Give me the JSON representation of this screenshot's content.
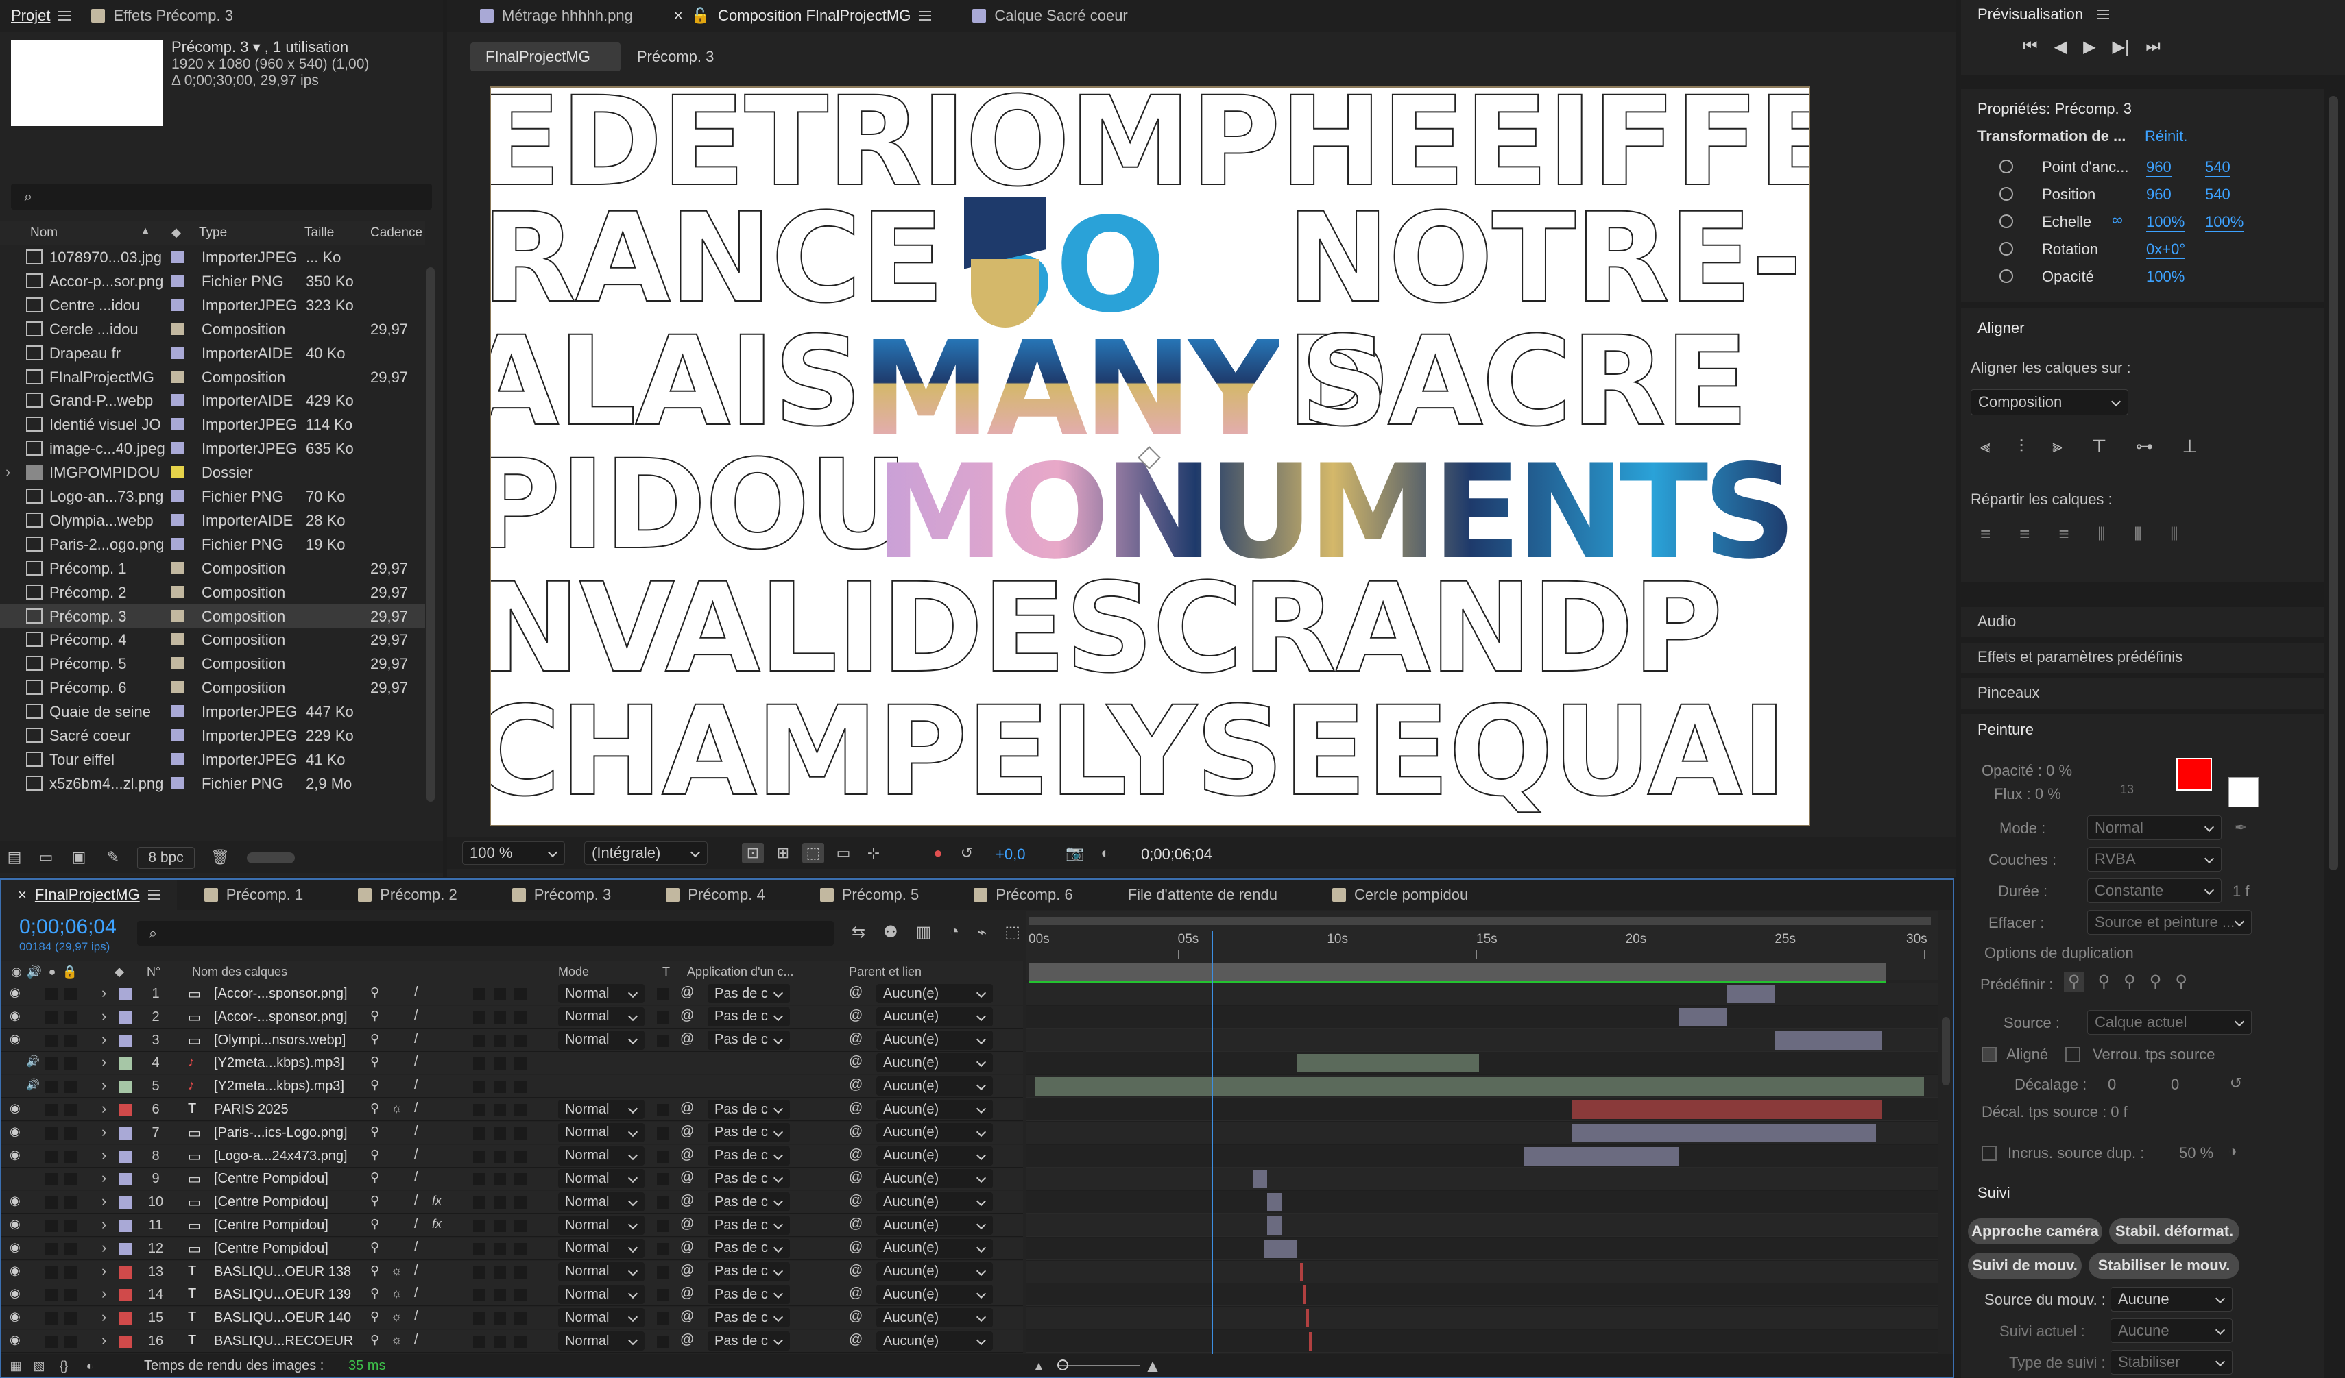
{
  "project": {
    "tab_project": "Projet",
    "tab_effects": "Effets Précomp. 3",
    "preview_name": "Précomp. 3 ▾ , 1 utilisation",
    "preview_dims": "1920 x 1080 (960 x 540) (1,00)",
    "preview_dur": "Δ 0;00;30;00, 29,97 ips",
    "search_placeholder": "",
    "columns": {
      "name": "Nom",
      "type": "Type",
      "size": "Taille",
      "rate": "Cadence"
    },
    "items": [
      {
        "name": "1078970...03.jpg",
        "type": "ImporterJPEG",
        "size": "... Ko",
        "rate": "",
        "color": "#a9a9d6",
        "icon": "image"
      },
      {
        "name": "Accor-p...sor.png",
        "type": "Fichier PNG",
        "size": "350 Ko",
        "rate": "",
        "color": "#a9a9d6",
        "icon": "image"
      },
      {
        "name": "Centre ...idou",
        "type": "ImporterJPEG",
        "size": "323 Ko",
        "rate": "",
        "color": "#a9a9d6",
        "icon": "image"
      },
      {
        "name": "Cercle ...idou",
        "type": "Composition",
        "size": "",
        "rate": "29,97",
        "color": "#c2b8a0",
        "icon": "comp"
      },
      {
        "name": "Drapeau fr",
        "type": "ImporterAIDE",
        "size": "40 Ko",
        "rate": "",
        "color": "#a9a9d6",
        "icon": "image"
      },
      {
        "name": "FInalProjectMG",
        "type": "Composition",
        "size": "",
        "rate": "29,97",
        "color": "#c2b8a0",
        "icon": "comp"
      },
      {
        "name": "Grand-P...webp",
        "type": "ImporterAIDE",
        "size": "429 Ko",
        "rate": "",
        "color": "#a9a9d6",
        "icon": "image"
      },
      {
        "name": "Identié visuel JO",
        "type": "ImporterJPEG",
        "size": "114 Ko",
        "rate": "",
        "color": "#a9a9d6",
        "icon": "image"
      },
      {
        "name": "image-c...40.jpeg",
        "type": "ImporterJPEG",
        "size": "635 Ko",
        "rate": "",
        "color": "#a9a9d6",
        "icon": "image"
      },
      {
        "name": "IMGPOMPIDOU",
        "type": "Dossier",
        "size": "",
        "rate": "",
        "color": "#e6d34a",
        "icon": "folder"
      },
      {
        "name": "Logo-an...73.png",
        "type": "Fichier PNG",
        "size": "70 Ko",
        "rate": "",
        "color": "#a9a9d6",
        "icon": "image"
      },
      {
        "name": "Olympia...webp",
        "type": "ImporterAIDE",
        "size": "28 Ko",
        "rate": "",
        "color": "#a9a9d6",
        "icon": "image"
      },
      {
        "name": "Paris-2...ogo.png",
        "type": "Fichier PNG",
        "size": "19 Ko",
        "rate": "",
        "color": "#a9a9d6",
        "icon": "image"
      },
      {
        "name": "Précomp. 1",
        "type": "Composition",
        "size": "",
        "rate": "29,97",
        "color": "#c2b8a0",
        "icon": "comp"
      },
      {
        "name": "Précomp. 2",
        "type": "Composition",
        "size": "",
        "rate": "29,97",
        "color": "#c2b8a0",
        "icon": "comp"
      },
      {
        "name": "Précomp. 3",
        "type": "Composition",
        "size": "",
        "rate": "29,97",
        "color": "#c2b8a0",
        "icon": "comp",
        "selected": true
      },
      {
        "name": "Précomp. 4",
        "type": "Composition",
        "size": "",
        "rate": "29,97",
        "color": "#c2b8a0",
        "icon": "comp"
      },
      {
        "name": "Précomp. 5",
        "type": "Composition",
        "size": "",
        "rate": "29,97",
        "color": "#c2b8a0",
        "icon": "comp"
      },
      {
        "name": "Précomp. 6",
        "type": "Composition",
        "size": "",
        "rate": "29,97",
        "color": "#c2b8a0",
        "icon": "comp"
      },
      {
        "name": "Quaie de seine",
        "type": "ImporterJPEG",
        "size": "447 Ko",
        "rate": "",
        "color": "#a9a9d6",
        "icon": "image"
      },
      {
        "name": "Sacré coeur",
        "type": "ImporterJPEG",
        "size": "229 Ko",
        "rate": "",
        "color": "#a9a9d6",
        "icon": "image"
      },
      {
        "name": "Tour eiffel",
        "type": "ImporterJPEG",
        "size": "41 Ko",
        "rate": "",
        "color": "#a9a9d6",
        "icon": "image"
      },
      {
        "name": "x5z6bm4...zl.png",
        "type": "Fichier PNG",
        "size": "2,9 Mo",
        "rate": "",
        "color": "#a9a9d6",
        "icon": "image"
      }
    ],
    "bpc": "8 bpc"
  },
  "viewer": {
    "tabs": [
      "Métrage hhhhh.png",
      "Composition FInalProjectMG",
      "Calque Sacré coeur"
    ],
    "crumbs": [
      "FInalProjectMG",
      "Précomp. 3"
    ],
    "zoom": "100 %",
    "resolution": "(Intégrale)",
    "exposure": "+0,0",
    "timecode": "0;00;06;04",
    "canvas_rows": [
      "EDETRIOMPHEEIFFE",
      "RANCE",
      "SO",
      "NOTRE-D",
      "ALAIS",
      "MANY",
      "SACRE",
      "PIDOU",
      "MONUMENTS",
      "NVALIDESCRANDP",
      "CHAMPELYSEEQUAI"
    ]
  },
  "right": {
    "preview_title": "Prévisualisation",
    "props_title": "Propriétés: Précomp. 3",
    "transform_label": "Transformation de ...",
    "reset_label": "Réinit.",
    "props": [
      {
        "label": "Point d'anc...",
        "v1": "960",
        "v2": "540"
      },
      {
        "label": "Position",
        "v1": "960",
        "v2": "540"
      },
      {
        "label": "Echelle",
        "v1": "100%",
        "v2": "100%"
      },
      {
        "label": "Rotation",
        "v1": "0x+0°",
        "v2": ""
      },
      {
        "label": "Opacité",
        "v1": "100%",
        "v2": ""
      }
    ],
    "align_title": "Aligner",
    "align_on_label": "Aligner les calques sur :",
    "align_on_value": "Composition",
    "distribute_label": "Répartir les calques :",
    "audio_label": "Audio",
    "effects_label": "Effets et paramètres prédéfinis",
    "brushes_label": "Pinceaux",
    "paint_title": "Peinture",
    "paint": {
      "opacity": "Opacité : 0 %",
      "flow": "Flux : 0 %",
      "thirteen": "13",
      "mode_label": "Mode :",
      "mode_value": "Normal",
      "layers_label": "Couches :",
      "layers_value": "RVBA",
      "duration_label": "Durée :",
      "duration_value": "Constante",
      "duration_f": "1 f",
      "erase_label": "Effacer :",
      "erase_value": "Source et peinture ...",
      "dup_label": "Options de duplication",
      "preset_label": "Prédéfinir :",
      "source_label": "Source :",
      "source_value": "Calque actuel",
      "aligned_label": "Aligné",
      "lock_label": "Verrou. tps source",
      "offset_label": "Décalage :",
      "offset_x": "0",
      "offset_y": "0",
      "time_offset_label": "Décal. tps source : 0  f",
      "incr_label": "Incrus. source dup. :",
      "incr_value": "50 %",
      "fg_color": "#ff0000"
    },
    "track_title": "Suivi",
    "track_buttons": [
      "Approche caméra",
      "Stabil. déformat.",
      "Suivi de mouv.",
      "Stabiliser le mouv."
    ],
    "track_source_label": "Source du mouv. :",
    "track_source_value": "Aucune",
    "track_current_label": "Suivi actuel :",
    "track_current_value": "Aucune",
    "track_type_label": "Type de suivi :",
    "track_type_value": "Stabiliser"
  },
  "timeline": {
    "tabs": [
      "FInalProjectMG",
      "Précomp. 1",
      "Précomp. 2",
      "Précomp. 3",
      "Précomp. 4",
      "Précomp. 5",
      "Précomp. 6",
      "File d'attente de rendu",
      "Cercle pompidou"
    ],
    "timecode": "0;00;06;04",
    "frames": "00184 (29,97 ips)",
    "headers": {
      "num": "N°",
      "name": "Nom des calques",
      "mode": "Mode",
      "t": "T",
      "app": "Application d'un c...",
      "parent": "Parent et lien"
    },
    "ruler": [
      "00s",
      "05s",
      "10s",
      "15s",
      "20s",
      "25s",
      "30s"
    ],
    "duration_s": 30,
    "current_s": 6.13,
    "layers": [
      {
        "n": "1",
        "name": "[Accor-...sponsor.png]",
        "kind": "img",
        "color": "#a9a9d6",
        "mode": "Normal",
        "app": "Pas de c",
        "parent": "Aucun(e)",
        "bar": [
          23.4,
          25.0
        ],
        "bar_color": "#6b6b80",
        "eye": true
      },
      {
        "n": "2",
        "name": "[Accor-...sponsor.png]",
        "kind": "img",
        "color": "#a9a9d6",
        "mode": "Normal",
        "app": "Pas de c",
        "parent": "Aucun(e)",
        "bar": [
          21.8,
          23.4
        ],
        "bar_color": "#6b6b80",
        "eye": true
      },
      {
        "n": "3",
        "name": "[Olympi...nsors.webp]",
        "kind": "img",
        "color": "#a9a9d6",
        "mode": "Normal",
        "app": "Pas de c",
        "parent": "Aucun(e)",
        "bar": [
          25.0,
          28.6
        ],
        "bar_color": "#6b6b80",
        "eye": true
      },
      {
        "n": "4",
        "name": "[Y2meta...kbps).mp3]",
        "kind": "audio",
        "color": "#a6c6a6",
        "mode": "",
        "app": "",
        "parent": "Aucun(e)",
        "bar": [
          9.0,
          15.1
        ],
        "bar_color": "#5b6a5b",
        "eye": false
      },
      {
        "n": "5",
        "name": "[Y2meta...kbps).mp3]",
        "kind": "audio",
        "color": "#a6c6a6",
        "mode": "",
        "app": "",
        "parent": "Aucun(e)",
        "bar": [
          0.2,
          30.0
        ],
        "bar_color": "#5b6a5b",
        "eye": false
      },
      {
        "n": "6",
        "name": "PARIS 2025",
        "kind": "text",
        "color": "#d04a4a",
        "mode": "Normal",
        "app": "Pas de c",
        "parent": "Aucun(e)",
        "bar": [
          18.2,
          28.6
        ],
        "bar_color": "#8a3a3a",
        "eye": true
      },
      {
        "n": "7",
        "name": "[Paris-...ics-Logo.png]",
        "kind": "img",
        "color": "#a9a9d6",
        "mode": "Normal",
        "app": "Pas de c",
        "parent": "Aucun(e)",
        "bar": [
          18.2,
          28.4
        ],
        "bar_color": "#6b6b80",
        "eye": true
      },
      {
        "n": "8",
        "name": "[Logo-a...24x473.png]",
        "kind": "img",
        "color": "#a9a9d6",
        "mode": "Normal",
        "app": "Pas de c",
        "parent": "Aucun(e)",
        "bar": [
          16.6,
          21.8
        ],
        "bar_color": "#6b6b80",
        "eye": true
      },
      {
        "n": "9",
        "name": "[Centre Pompidou]",
        "kind": "img",
        "color": "#a9a9d6",
        "mode": "Normal",
        "app": "Pas de c",
        "parent": "Aucun(e)",
        "bar": [
          7.5,
          8.0
        ],
        "bar_color": "#6b6b80",
        "eye": false
      },
      {
        "n": "10",
        "name": "[Centre Pompidou]",
        "kind": "img",
        "color": "#a9a9d6",
        "mode": "Normal",
        "app": "Pas de c",
        "parent": "Aucun(e)",
        "bar": [
          8.0,
          8.5
        ],
        "bar_color": "#6b6b80",
        "eye": true,
        "fx": true
      },
      {
        "n": "11",
        "name": "[Centre Pompidou]",
        "kind": "img",
        "color": "#a9a9d6",
        "mode": "Normal",
        "app": "Pas de c",
        "parent": "Aucun(e)",
        "bar": [
          8.0,
          8.5
        ],
        "bar_color": "#6b6b80",
        "eye": true,
        "fx": true
      },
      {
        "n": "12",
        "name": "[Centre Pompidou]",
        "kind": "img",
        "color": "#a9a9d6",
        "mode": "Normal",
        "app": "Pas de c",
        "parent": "Aucun(e)",
        "bar": [
          7.9,
          9.0
        ],
        "bar_color": "#6b6b80",
        "eye": true
      },
      {
        "n": "13",
        "name": "BASLIQU...OEUR 138",
        "kind": "text",
        "color": "#d04a4a",
        "mode": "Normal",
        "app": "Pas de c",
        "parent": "Aucun(e)",
        "bar": [
          9.1,
          9.2
        ],
        "bar_color": "#b04040",
        "eye": true
      },
      {
        "n": "14",
        "name": "BASLIQU...OEUR 139",
        "kind": "text",
        "color": "#d04a4a",
        "mode": "Normal",
        "app": "Pas de c",
        "parent": "Aucun(e)",
        "bar": [
          9.2,
          9.3
        ],
        "bar_color": "#b04040",
        "eye": true
      },
      {
        "n": "15",
        "name": "BASLIQU...OEUR 140",
        "kind": "text",
        "color": "#d04a4a",
        "mode": "Normal",
        "app": "Pas de c",
        "parent": "Aucun(e)",
        "bar": [
          9.3,
          9.4
        ],
        "bar_color": "#b04040",
        "eye": true
      },
      {
        "n": "16",
        "name": "BASLIQU...RECOEUR",
        "kind": "text",
        "color": "#d04a4a",
        "mode": "Normal",
        "app": "Pas de c",
        "parent": "Aucun(e)",
        "bar": [
          9.4,
          9.5
        ],
        "bar_color": "#b04040",
        "eye": true
      }
    ],
    "render_label": "Temps de rendu des images :",
    "render_value": "35 ms"
  }
}
